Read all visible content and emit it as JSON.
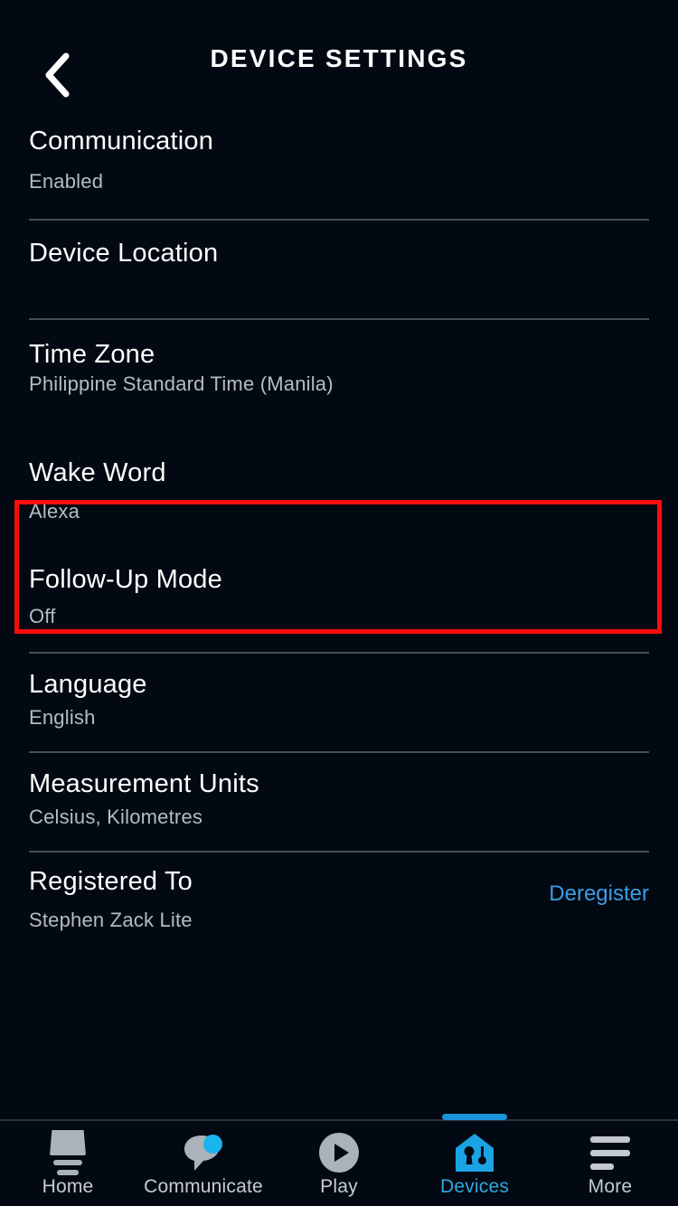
{
  "header": {
    "title": "DEVICE SETTINGS",
    "back_icon": "chevron-left-icon"
  },
  "settings": {
    "rows": [
      {
        "key": "communication",
        "title": "Communication",
        "subtitle": "Enabled"
      },
      {
        "key": "device_location",
        "title": "Device Location",
        "subtitle": ""
      },
      {
        "key": "time_zone",
        "title": "Time Zone",
        "subtitle": "Philippine Standard Time (Manila)"
      },
      {
        "key": "wake_word",
        "title": "Wake Word",
        "subtitle": "Alexa",
        "highlighted": true
      },
      {
        "key": "follow_up_mode",
        "title": "Follow-Up Mode",
        "subtitle": "Off"
      },
      {
        "key": "language",
        "title": "Language",
        "subtitle": "English"
      },
      {
        "key": "measurement",
        "title": "Measurement Units",
        "subtitle": "Celsius, Kilometres"
      },
      {
        "key": "registered_to",
        "title": "Registered To",
        "subtitle": "Stephen Zack Lite",
        "action": "Deregister"
      }
    ]
  },
  "highlight": {
    "color": "#fb0d0d",
    "target": "wake-word-row"
  },
  "bottom_nav": {
    "active": "Devices",
    "items": [
      {
        "label": "Home",
        "icon": "echo-device-icon",
        "active": false,
        "badge": false
      },
      {
        "label": "Communicate",
        "icon": "speech-bubble-icon",
        "active": false,
        "badge": true
      },
      {
        "label": "Play",
        "icon": "play-circle-icon",
        "active": false,
        "badge": false
      },
      {
        "label": "Devices",
        "icon": "smart-home-icon",
        "active": true,
        "badge": false
      },
      {
        "label": "More",
        "icon": "hamburger-icon",
        "active": false,
        "badge": false
      }
    ]
  },
  "colors": {
    "background": "#020912",
    "accent_blue": "#31a8e0",
    "link_blue": "#3d9de4",
    "highlight_red": "#fb0d0d",
    "divider": "#464d55",
    "subtitle": "#b4bcc4"
  }
}
